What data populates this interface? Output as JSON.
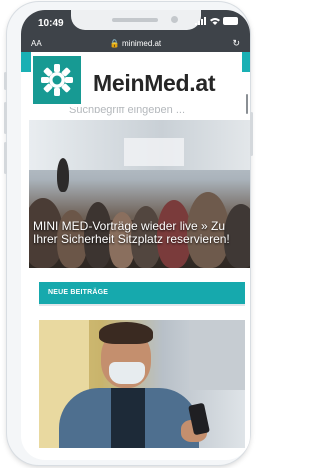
{
  "status_bar": {
    "time": "10:49"
  },
  "browser": {
    "text_size_label": "AA",
    "url": "minimed.at",
    "reload_icon": "reload-icon"
  },
  "site": {
    "logo_text": "MeinMed.at",
    "logo_icon": "sun-gear-logo-icon",
    "search_hint": "Suchbegriff eingeben ..."
  },
  "hero": {
    "title": "MINI MED-Vorträge wieder live » Zu Ihrer Sicherheit Sitzplatz reservieren!"
  },
  "section": {
    "heading": "NEUE BEITRÄGE"
  },
  "colors": {
    "accent": "#16a9ad",
    "logo_bg": "#179a93",
    "status_bar": "#3e4349"
  }
}
